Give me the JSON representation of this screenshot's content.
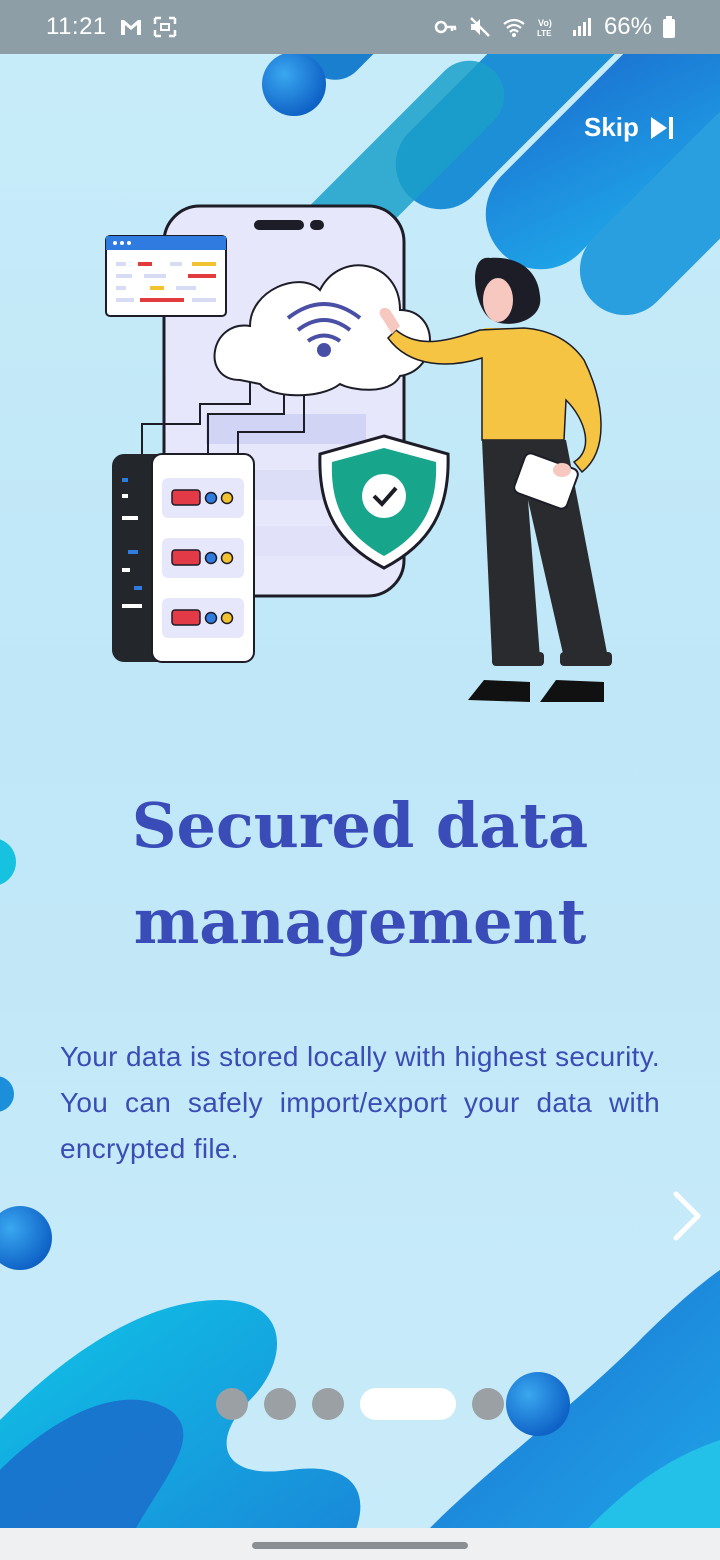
{
  "status_bar": {
    "time": "11:21",
    "battery": "66%",
    "left_icons": [
      "gmail-icon",
      "screenshot-icon"
    ],
    "right_icons": [
      "vpn-key-icon",
      "mute-icon",
      "wifi-icon",
      "volte-icon",
      "signal-icon",
      "battery-icon"
    ]
  },
  "onboarding": {
    "skip_label": "Skip",
    "title_line1": "Secured data",
    "title_line2": "management",
    "description": "Your data is stored locally with highest security. You can safely import/export your data with encrypted file.",
    "page_count": 5,
    "active_page_index": 3
  },
  "colors": {
    "background": "#c3e8f8",
    "title": "#3a4cb8",
    "description": "#3b4db5",
    "accent_blue": "#1f8fdb",
    "dot_inactive": "#9aa0a4",
    "dot_active": "#ffffff"
  }
}
